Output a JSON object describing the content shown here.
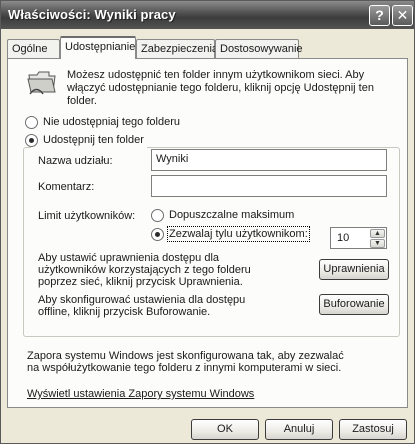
{
  "window": {
    "title": "Właściwości: Wyniki pracy",
    "help_glyph": "?",
    "close_glyph": "✕"
  },
  "tabs": [
    {
      "label": "Ogólne",
      "active": false
    },
    {
      "label": "Udostępnianie",
      "active": true
    },
    {
      "label": "Zabezpieczenia",
      "active": false
    },
    {
      "label": "Dostosowywanie",
      "active": false
    }
  ],
  "sharing": {
    "intro": "Możesz udostępnić ten folder innym użytkownikom sieci. Aby włączyć udostępnianie tego folderu, kliknij opcję Udostępnij ten folder.",
    "do_not_share_label": "Nie udostępniaj tego folderu",
    "share_label": "Udostępnij ten folder",
    "selected_option": "share",
    "share_name_label": "Nazwa udziału:",
    "share_name_value": "Wyniki",
    "comment_label": "Komentarz:",
    "comment_value": "",
    "user_limit_label": "Limit użytkowników:",
    "max_allowed_label": "Dopuszczalne maksimum",
    "allow_users_label": "Zezwalaj tylu użytkownikom:",
    "user_limit_mode": "allow",
    "user_count": "10",
    "permissions_text": "Aby ustawić uprawnienia dostępu dla użytkowników korzystających z tego folderu poprzez sieć, kliknij przycisk Uprawnienia.",
    "permissions_button": "Uprawnienia",
    "caching_text": "Aby skonfigurować ustawienia dla dostępu offline, kliknij przycisk Buforowanie.",
    "caching_button": "Buforowanie"
  },
  "firewall": {
    "info_text": "Zapora systemu Windows jest skonfigurowana tak, aby zezwalać na współużytkowanie tego folderu z innymi komputerami w sieci.",
    "settings_link": "Wyświetl ustawienia Zapory systemu Windows"
  },
  "buttons": {
    "ok": "OK",
    "cancel": "Anuluj",
    "apply": "Zastosuj"
  }
}
